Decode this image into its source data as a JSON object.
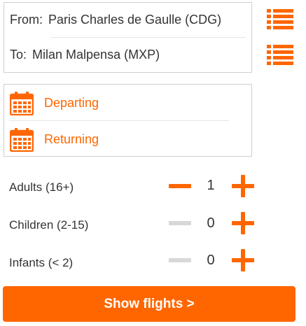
{
  "route": {
    "from_label": "From:",
    "from_value": "Paris Charles de Gaulle (CDG)",
    "to_label": "To:",
    "to_value": "Milan Malpensa (MXP)",
    "list_icon": "list-icon"
  },
  "dates": {
    "departing_label": "Departing",
    "returning_label": "Returning",
    "icon": "calendar-icon"
  },
  "passengers": [
    {
      "label": "Adults (16+)",
      "count": "1",
      "minus_enabled": true,
      "plus_enabled": true
    },
    {
      "label": "Children (2-15)",
      "count": "0",
      "minus_enabled": false,
      "plus_enabled": true
    },
    {
      "label": "Infants (< 2)",
      "count": "0",
      "minus_enabled": false,
      "plus_enabled": true
    }
  ],
  "submit": {
    "label": "Show flights >"
  },
  "colors": {
    "accent": "#ff6600",
    "disabled": "#d8d8d8",
    "border": "#cfcfcf",
    "text": "#333333"
  }
}
